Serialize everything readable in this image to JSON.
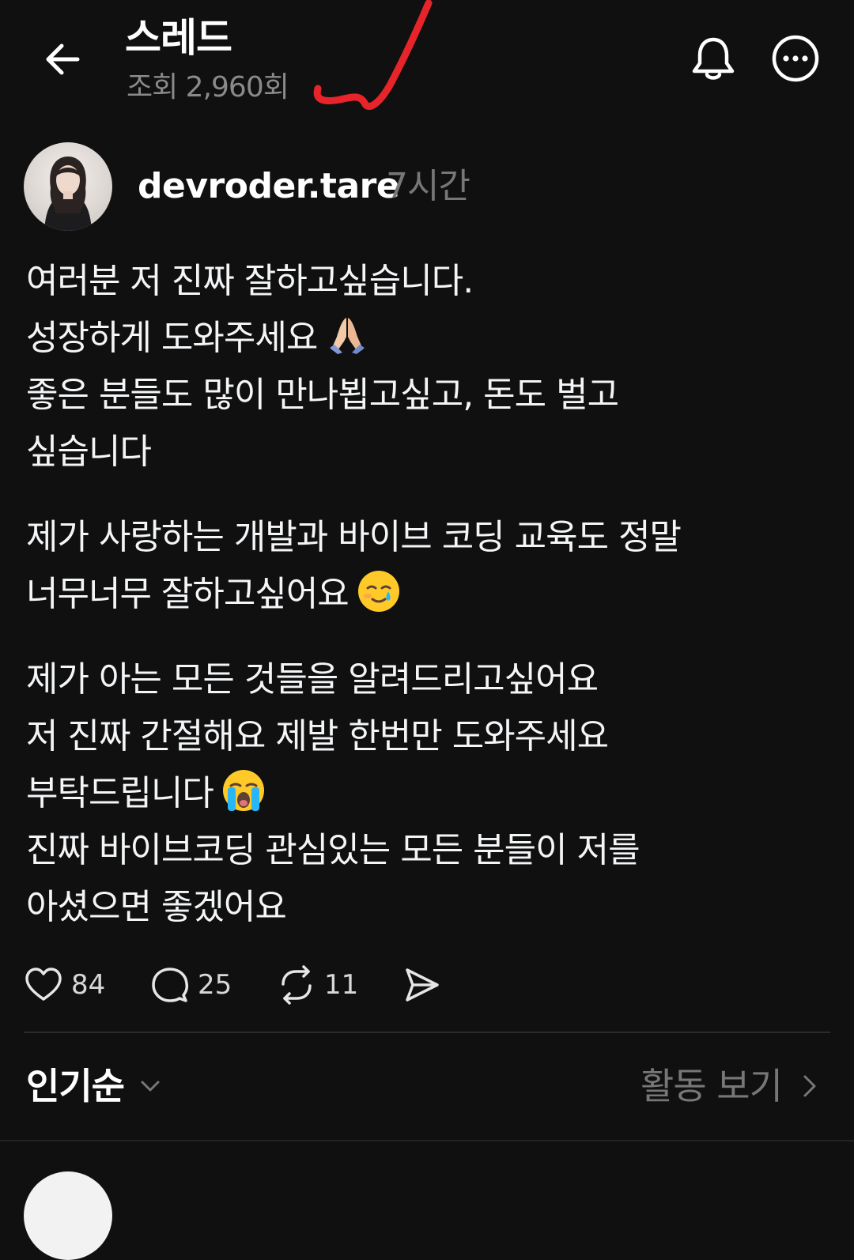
{
  "header": {
    "title": "스레드",
    "views": "조회 2,960회",
    "back_icon": "arrow-left-icon",
    "notification_icon": "bell-icon",
    "more_icon": "more-horizontal-icon"
  },
  "post": {
    "author": "devroder.tare",
    "time": "7시간",
    "paragraphs": [
      [
        "여러분 저 진짜 잘하고싶습니다.",
        "성장하게 도와주세요",
        "좋은 분들도 많이 만나뵙고싶고, 돈도 벌고",
        "싶습니다"
      ],
      [
        "제가 사랑하는 개발과 바이브 코딩 교육도 정말",
        "너무너무 잘하고싶어요"
      ],
      [
        "제가 아는 모든 것들을 알려드리고싶어요",
        "저 진짜 간절해요 제발 한번만 도와주세요",
        "부탁드립니다",
        "진짜 바이브코딩 관심있는 모든 분들이 저를",
        "아셨으면 좋겠어요"
      ]
    ],
    "emojis": {
      "folded_hands": "folded-hands-emoji",
      "tear_smile": "smiling-face-with-tear-emoji",
      "crying": "loudly-crying-face-emoji"
    },
    "actions": {
      "likes": "84",
      "replies": "25",
      "reposts": "11"
    }
  },
  "sort": {
    "label": "인기순",
    "activity": "활동 보기"
  },
  "colors": {
    "background": "#101010",
    "text": "#f3f5f7",
    "muted": "#777777",
    "annotation": "#e8242b"
  }
}
